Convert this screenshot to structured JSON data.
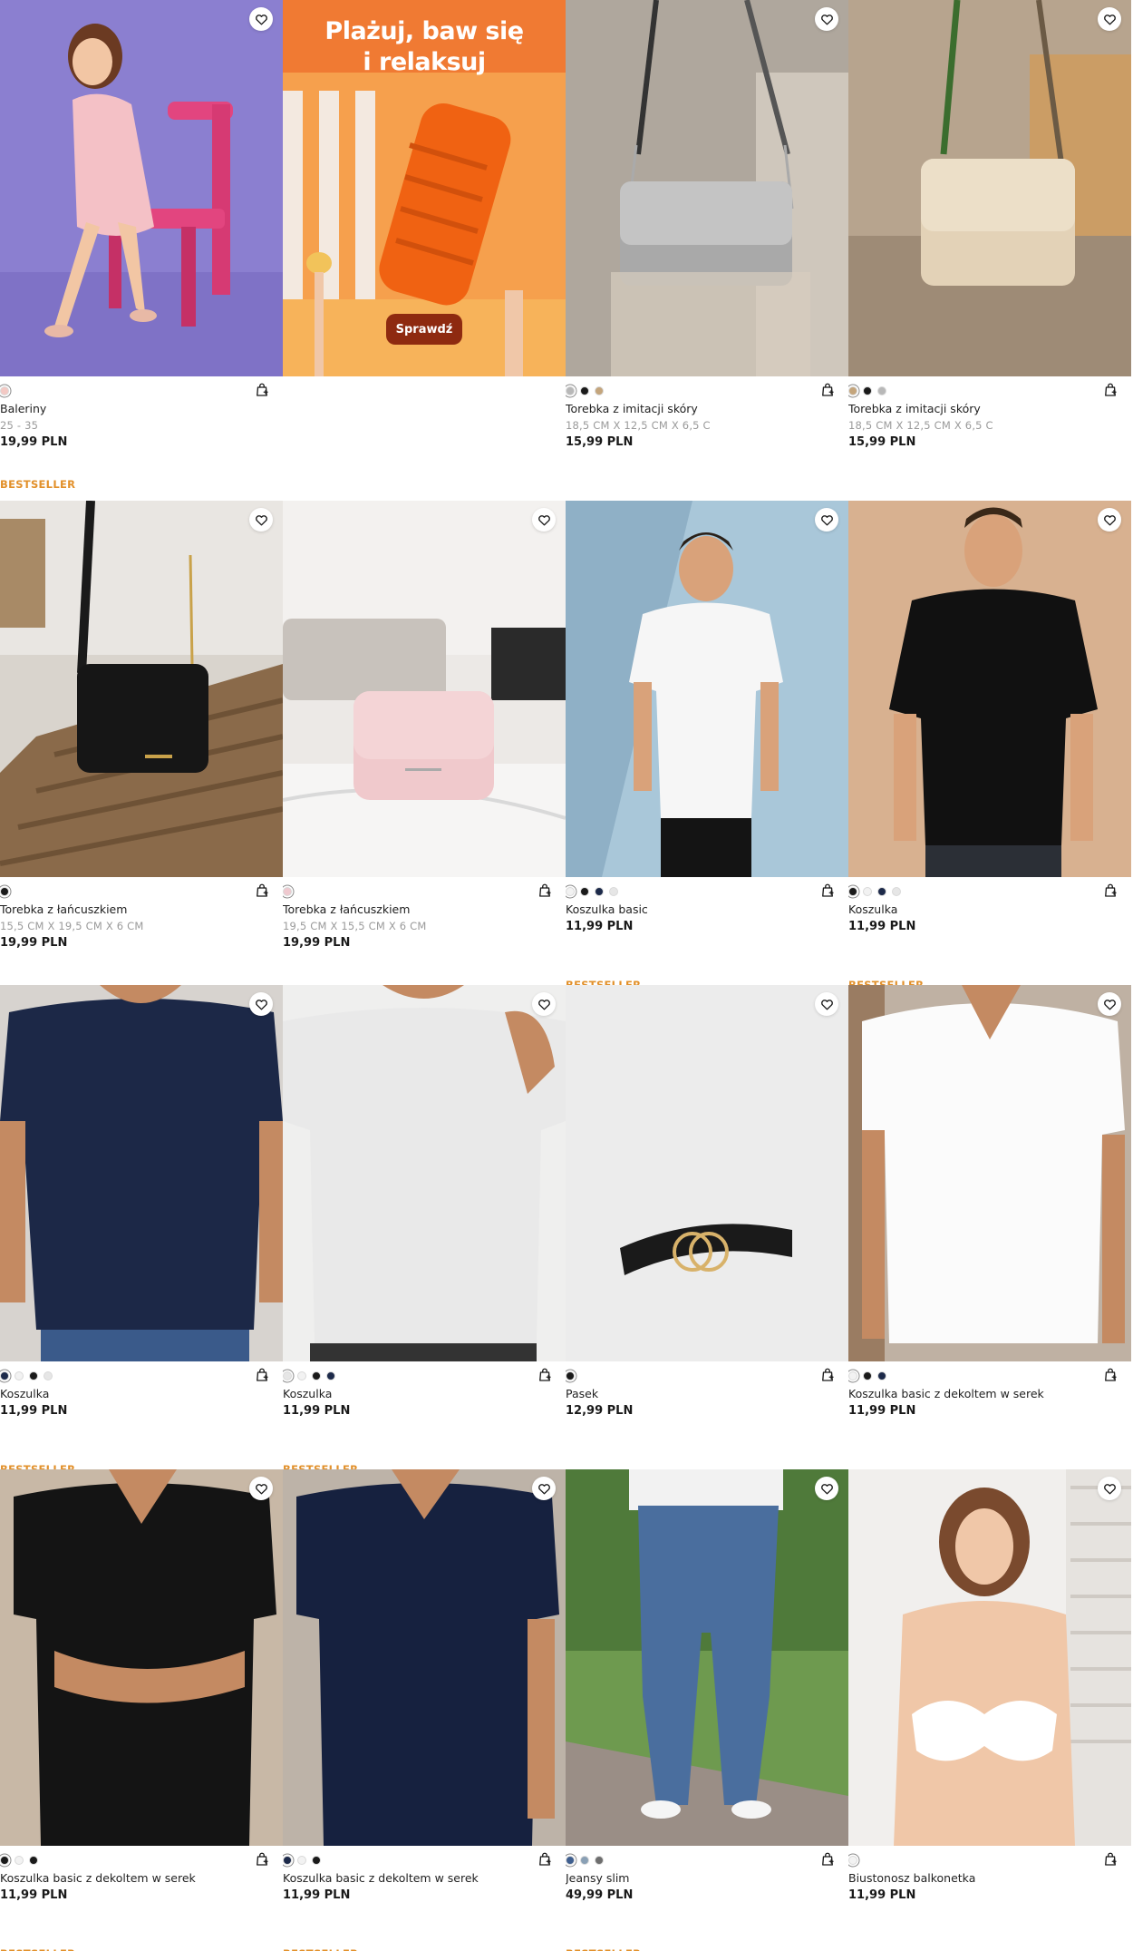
{
  "colors": {
    "bestseller": "#e2902a",
    "price": "#1a1a1a",
    "subtitle": "#9a9a9a",
    "banner_cta": "#8e2a10"
  },
  "icons": {
    "favorite": "heart-icon",
    "add_to_cart": "cart-add-icon"
  },
  "banner": {
    "title": "Plażuj, baw się\ni relaksuj",
    "cta": "Sprawdź"
  },
  "products": [
    {
      "name": "Baleriny",
      "sub": "25 - 35",
      "price": "19,99 PLN",
      "badge": "BESTSELLER",
      "swatches": [
        "#f3c9c4"
      ],
      "image": "girl-pink-dress-purple"
    },
    {
      "banner": true
    },
    {
      "name": "Torebka z imitacji skóry",
      "sub": "18,5 CM X 12,5 CM X 6,5 C",
      "price": "15,99 PLN",
      "badge": "",
      "swatches": [
        "#b8b8b8",
        "#1a1a1a",
        "#c4a57c"
      ],
      "image": "bag-silver"
    },
    {
      "name": "Torebka z imitacji skóry",
      "sub": "18,5 CM X 12,5 CM X 6,5 C",
      "price": "15,99 PLN",
      "badge": "",
      "swatches": [
        "#c4a57c",
        "#1a1a1a",
        "#b8b8b8"
      ],
      "image": "bag-beige"
    },
    {
      "name": "Torebka z łańcuszkiem",
      "sub": "15,5 CM X 19,5 CM X 6 CM",
      "price": "19,99 PLN",
      "badge": "",
      "swatches": [
        "#1a1a1a"
      ],
      "image": "bag-black"
    },
    {
      "name": "Torebka z łańcuszkiem",
      "sub": "19,5 CM X 15,5 CM X 6 CM",
      "price": "19,99 PLN",
      "badge": "",
      "swatches": [
        "#efc9cf"
      ],
      "image": "bag-pink"
    },
    {
      "name": "Koszulka basic",
      "sub": "",
      "price": "11,99 PLN",
      "badge": "BESTSELLER",
      "swatches": [
        "#f2f2f2",
        "#1a1a1a",
        "#1d2a4a",
        "#e6e6e6"
      ],
      "image": "man-white-tee-blue"
    },
    {
      "name": "Koszulka",
      "sub": "",
      "price": "11,99 PLN",
      "badge": "BESTSELLER",
      "swatches": [
        "#1a1a1a",
        "#f2f2f2",
        "#1d2a4a",
        "#e6e6e6"
      ],
      "image": "man-black-tee"
    },
    {
      "name": "Koszulka",
      "sub": "",
      "price": "11,99 PLN",
      "badge": "BESTSELLER",
      "swatches": [
        "#1d2a4a",
        "#f2f2f2",
        "#1a1a1a",
        "#e6e6e6"
      ],
      "image": "navy-tee"
    },
    {
      "name": "Koszulka",
      "sub": "",
      "price": "11,99 PLN",
      "badge": "BESTSELLER",
      "swatches": [
        "#e6e6e6",
        "#f2f2f2",
        "#1a1a1a",
        "#1d2a4a"
      ],
      "image": "grey-tee"
    },
    {
      "name": "Pasek",
      "sub": "",
      "price": "12,99 PLN",
      "badge": "",
      "swatches": [
        "#1a1a1a"
      ],
      "image": "belt"
    },
    {
      "name": "Koszulka basic z dekoltem w serek",
      "sub": "",
      "price": "11,99 PLN",
      "badge": "",
      "swatches": [
        "#f2f2f2",
        "#1a1a1a",
        "#1d2a4a"
      ],
      "image": "white-vneck"
    },
    {
      "name": "Koszulka basic z dekoltem w serek",
      "sub": "",
      "price": "11,99 PLN",
      "badge": "BESTSELLER",
      "swatches": [
        "#1a1a1a",
        "#f2f2f2",
        "#1a1a1a"
      ],
      "image": "black-vneck"
    },
    {
      "name": "Koszulka basic z dekoltem w serek",
      "sub": "",
      "price": "11,99 PLN",
      "badge": "BESTSELLER",
      "swatches": [
        "#1d2a4a",
        "#f2f2f2",
        "#1a1a1a"
      ],
      "image": "navy-vneck"
    },
    {
      "name": "Jeansy slim",
      "sub": "",
      "price": "49,99 PLN",
      "badge": "BESTSELLER",
      "swatches": [
        "#3f5f8f",
        "#8aa0b5",
        "#6e6e6e"
      ],
      "image": "jeans"
    },
    {
      "name": "Biustonosz balkonetka",
      "sub": "",
      "price": "11,99 PLN",
      "badge": "",
      "swatches": [
        "#f2f2f2"
      ],
      "image": "bra"
    }
  ]
}
